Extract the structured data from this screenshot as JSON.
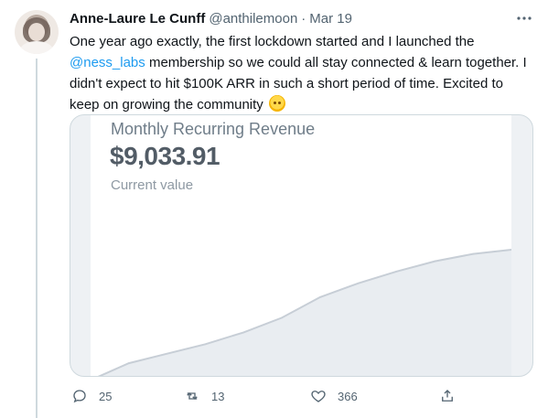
{
  "tweet": {
    "author_name": "Anne-Laure Le Cunff",
    "handle": "@anthilemoon",
    "separator": "·",
    "date": "Mar 19",
    "more_icon": "more-horizontal-icon",
    "text_before_mention": "One year ago exactly, the first lockdown started and I launched the ",
    "mention": "@ness_labs",
    "text_after_mention": " membership so we could all stay connected & learn together. I didn't expect to hit $100K ARR in such a short period of time. Excited to keep on growing the community ",
    "emoji": "smiling-face-with-hearts-icon"
  },
  "card": {
    "title": "Monthly Recurring Revenue",
    "value": "$9,033.91",
    "subtitle": "Current value"
  },
  "chart_data": {
    "type": "area",
    "title": "Monthly Recurring Revenue",
    "xlabel": "",
    "ylabel": "",
    "x": [
      1,
      2,
      3,
      4,
      5,
      6,
      7,
      8,
      9,
      10,
      11,
      12
    ],
    "values": [
      150,
      1300,
      1950,
      2600,
      3400,
      4400,
      5800,
      6750,
      7550,
      8250,
      8750,
      9033.91
    ],
    "color": "#e9edf1",
    "line_color": "#c7ced6",
    "grid": false
  },
  "actions": {
    "reply_count": "25",
    "retweet_count": "13",
    "like_count": "366",
    "reply_icon": "reply-icon",
    "retweet_icon": "retweet-icon",
    "like_icon": "heart-icon",
    "share_icon": "share-icon"
  },
  "colors": {
    "text": "#0f1419",
    "secondary": "#536471",
    "link": "#1d9bf0",
    "border": "#cfd9de"
  }
}
